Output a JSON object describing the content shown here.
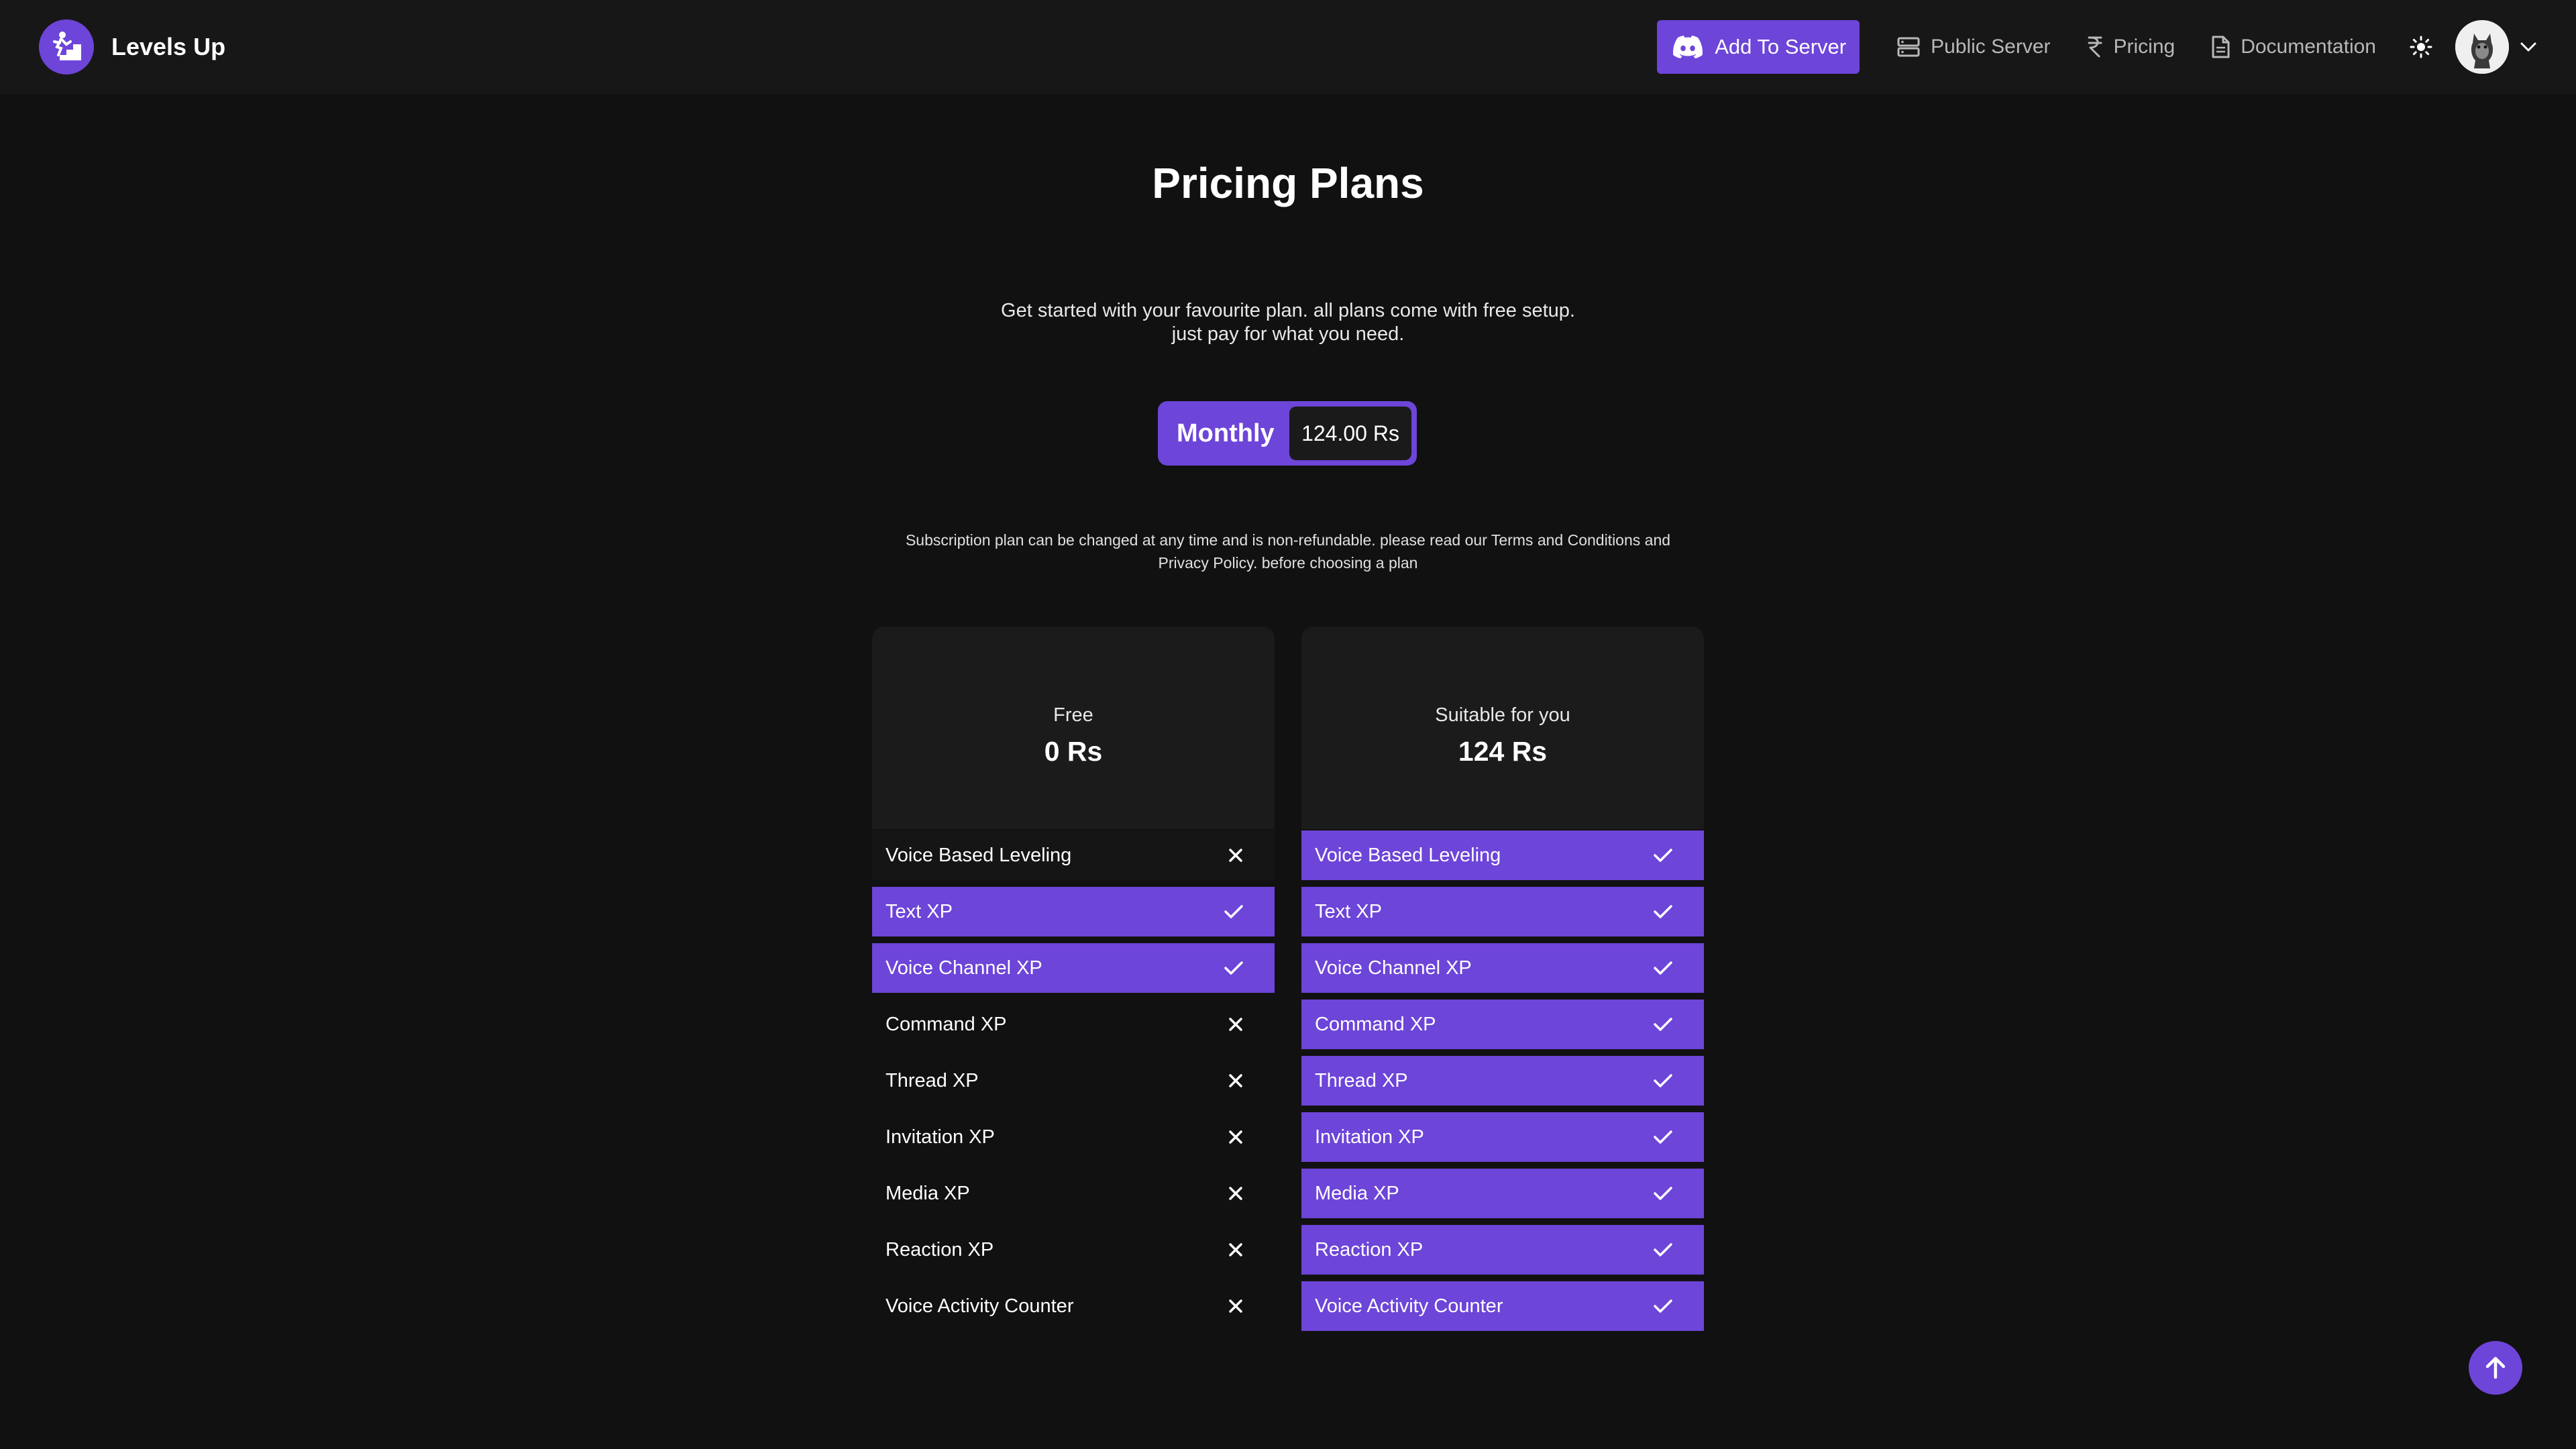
{
  "nav": {
    "brand": "Levels Up",
    "add_to_server": "Add To Server",
    "public_server": "Public Server",
    "pricing": "Pricing",
    "documentation": "Documentation"
  },
  "page": {
    "title": "Pricing Plans",
    "subtitle_line1": "Get started with your favourite plan. all plans come with free setup.",
    "subtitle_line2": "just pay for what you need.",
    "toggle_label": "Monthly",
    "toggle_price": "124.00 Rs",
    "notice_line1": "Subscription plan can be changed at any time and is non-refundable. please read our Terms and Conditions and",
    "notice_line2": "Privacy Policy. before choosing a plan"
  },
  "plans": [
    {
      "name": "Free",
      "price": "0 Rs",
      "features": [
        {
          "label": "Voice Based Leveling",
          "included": false
        },
        {
          "label": "Text XP",
          "included": true
        },
        {
          "label": "Voice Channel XP",
          "included": true
        },
        {
          "label": "Command XP",
          "included": false
        },
        {
          "label": "Thread XP",
          "included": false
        },
        {
          "label": "Invitation XP",
          "included": false
        },
        {
          "label": "Media XP",
          "included": false
        },
        {
          "label": "Reaction XP",
          "included": false
        },
        {
          "label": "Voice Activity Counter",
          "included": false
        }
      ]
    },
    {
      "name": "Suitable for you",
      "price": "124 Rs",
      "features": [
        {
          "label": "Voice Based Leveling",
          "included": true
        },
        {
          "label": "Text XP",
          "included": true
        },
        {
          "label": "Voice Channel XP",
          "included": true
        },
        {
          "label": "Command XP",
          "included": true
        },
        {
          "label": "Thread XP",
          "included": true
        },
        {
          "label": "Invitation XP",
          "included": true
        },
        {
          "label": "Media XP",
          "included": true
        },
        {
          "label": "Reaction XP",
          "included": true
        },
        {
          "label": "Voice Activity Counter",
          "included": true
        }
      ]
    }
  ],
  "colors": {
    "accent": "#6d45d8",
    "background": "#111111",
    "navbar": "#171717",
    "card": "#1b1b1b"
  },
  "icons": {
    "brand": "stairs-climber-icon",
    "add_to_server": "discord-icon",
    "public_server": "server-icon",
    "pricing": "rupee-icon",
    "documentation": "document-icon",
    "theme": "sun-icon",
    "profile": "avatar",
    "menu": "chevron-down-icon",
    "included": "check-icon",
    "excluded": "x-icon",
    "scroll": "arrow-up-icon"
  }
}
